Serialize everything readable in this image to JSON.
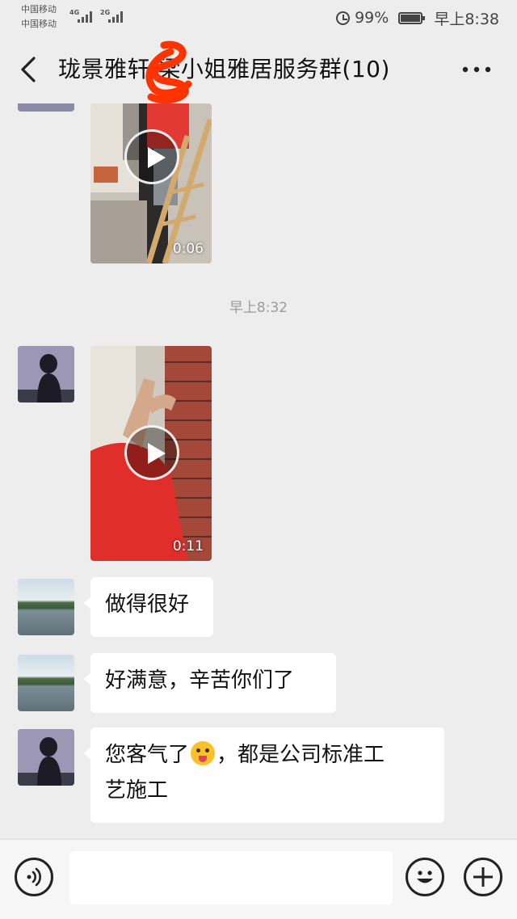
{
  "status_bar": {
    "carrier1": "中国移动",
    "carrier2": "中国移动",
    "net1": "4G",
    "net2": "2G",
    "battery": "99%",
    "time": "早上8:38"
  },
  "header": {
    "title": "珑景雅轩   梁小姐雅居服务群(10)"
  },
  "messages": {
    "video1_duration": "0:06",
    "time_separator": "早上8:32",
    "video2_duration": "0:11",
    "msg1": "做得很好",
    "msg2": "好满意，辛苦你们了",
    "msg3_part1": "您客气了",
    "msg3_part2": "，都是公司标准工",
    "msg3_part3": "艺施工"
  },
  "input_bar": {
    "placeholder": ""
  },
  "colors": {
    "background": "#ededed",
    "bubble": "#ffffff",
    "timestamp": "#9a9a9a",
    "scribble": "#ff3300"
  },
  "icons": [
    "back-arrow-icon",
    "more-icon",
    "alarm-icon",
    "battery-icon",
    "voice-icon",
    "emoji-icon",
    "plus-icon",
    "play-icon"
  ]
}
